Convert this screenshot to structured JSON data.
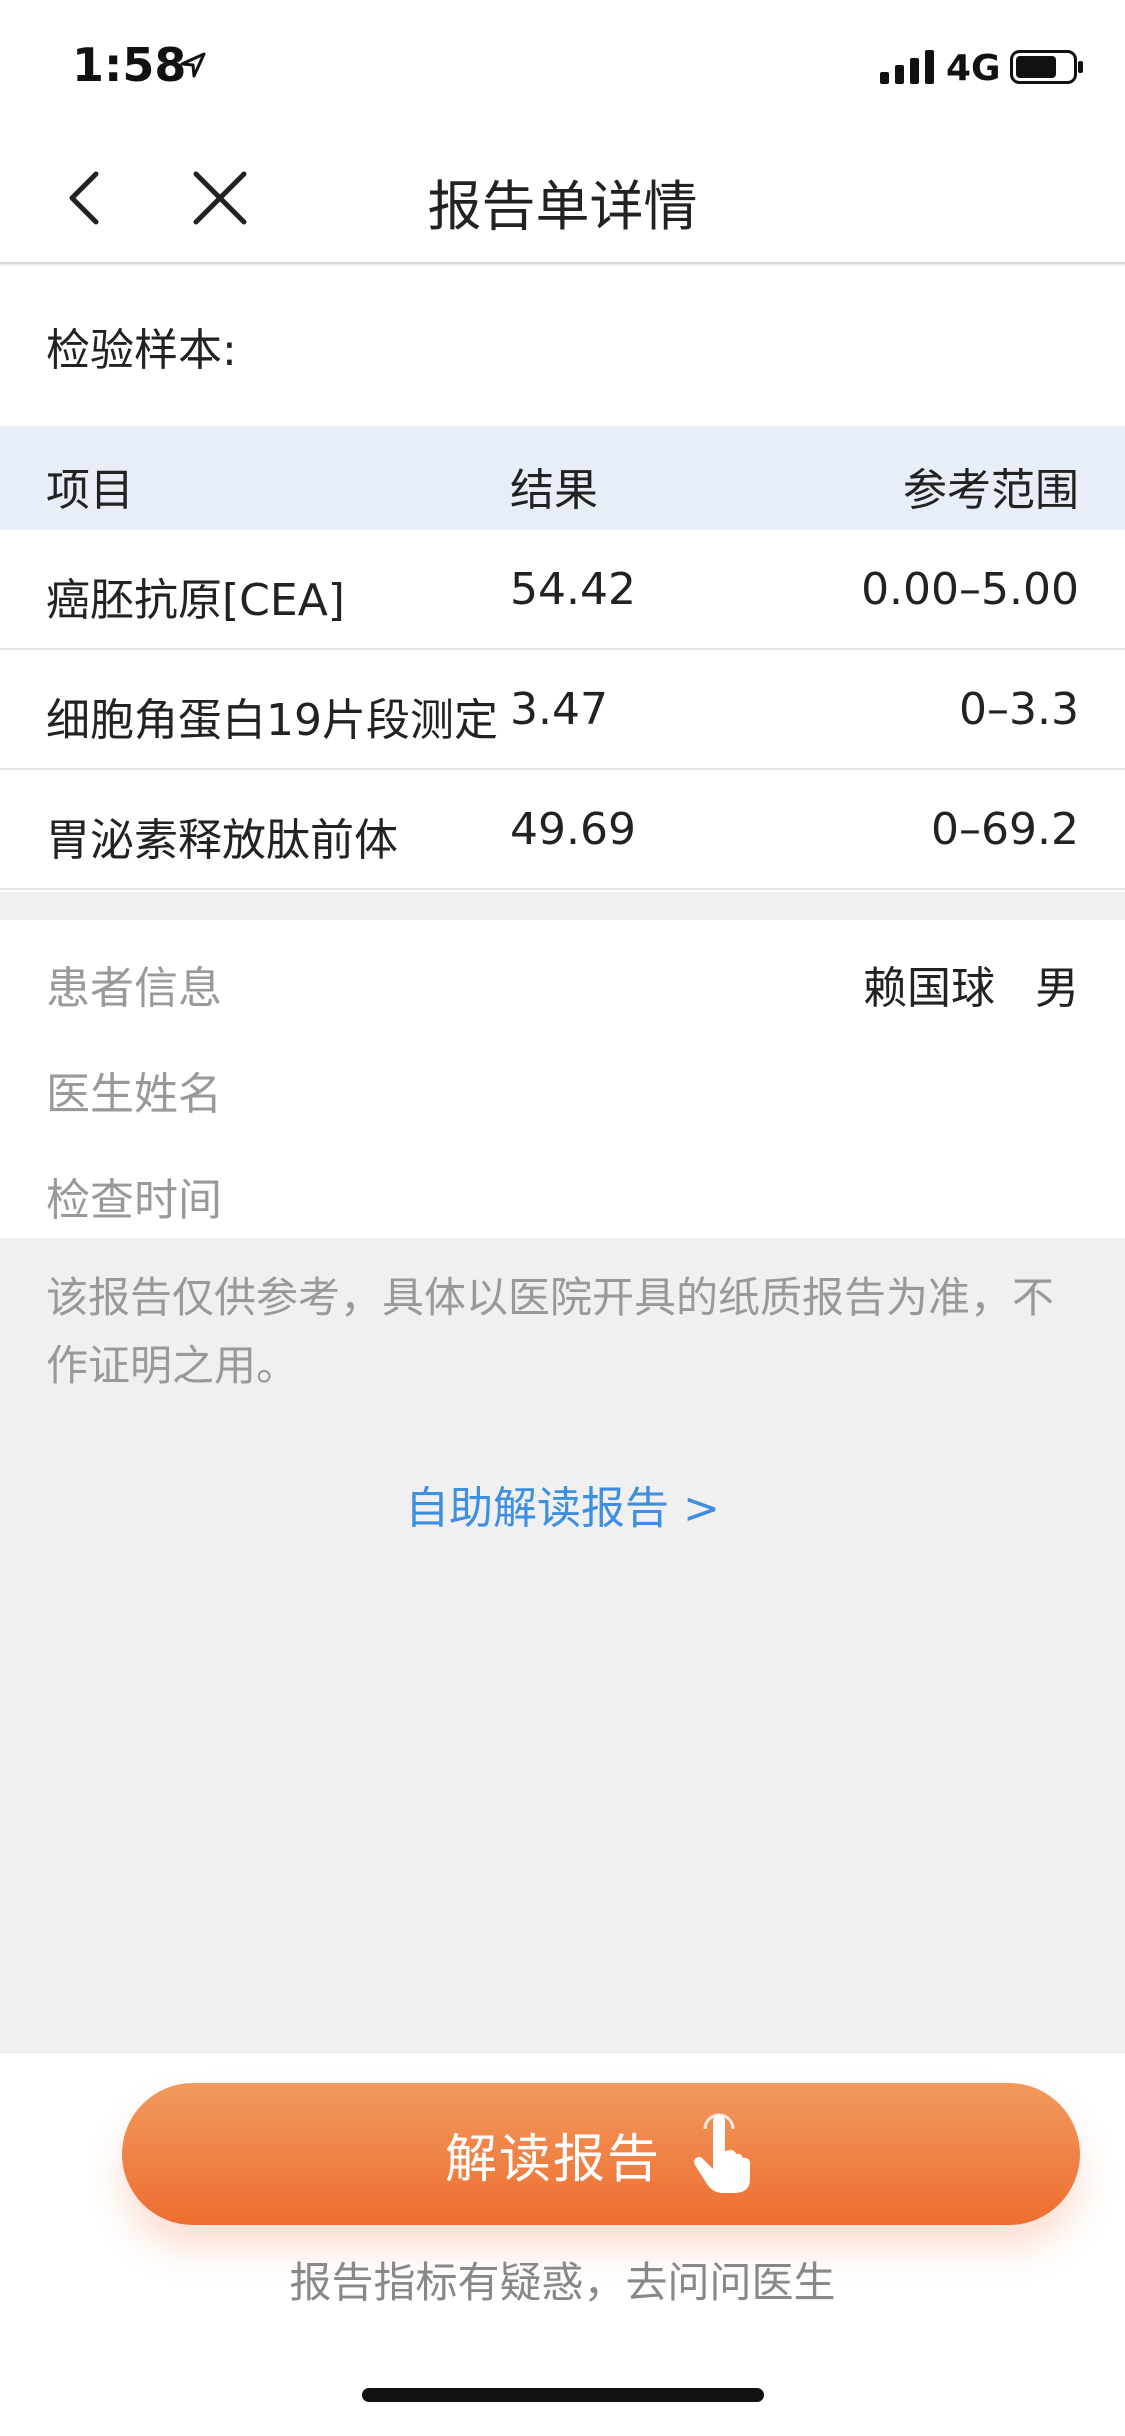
{
  "status_bar": {
    "time": "1:58",
    "network": "4G"
  },
  "nav": {
    "title": "报告单详情"
  },
  "sample": {
    "label": "检验样本:"
  },
  "table": {
    "headers": {
      "item": "项目",
      "result": "结果",
      "range": "参考范围"
    },
    "rows": [
      {
        "item": "癌胚抗原[CEA]",
        "result": "54.42",
        "range": "0.00–5.00"
      },
      {
        "item": "细胞角蛋白19片段测定",
        "result": "3.47",
        "range": "0–3.3"
      },
      {
        "item": "胃泌素释放肽前体",
        "result": "49.69",
        "range": "0–69.2"
      }
    ]
  },
  "info": {
    "patient_label": "患者信息",
    "patient_name": "赖国球",
    "patient_gender": "男",
    "doctor_label": "医生姓名",
    "time_label": "检查时间"
  },
  "disclaimer": "该报告仅供参考，具体以医院开具的纸质报告为准，不作证明之用。",
  "self_read_link": "自助解读报告 >",
  "bottom": {
    "button_label": "解读报告",
    "hint": "报告指标有疑惑，去问问医生"
  },
  "colors": {
    "accent_orange": "#ee6d30",
    "link_blue": "#3e8fe0",
    "header_bg": "#e8eef8"
  }
}
